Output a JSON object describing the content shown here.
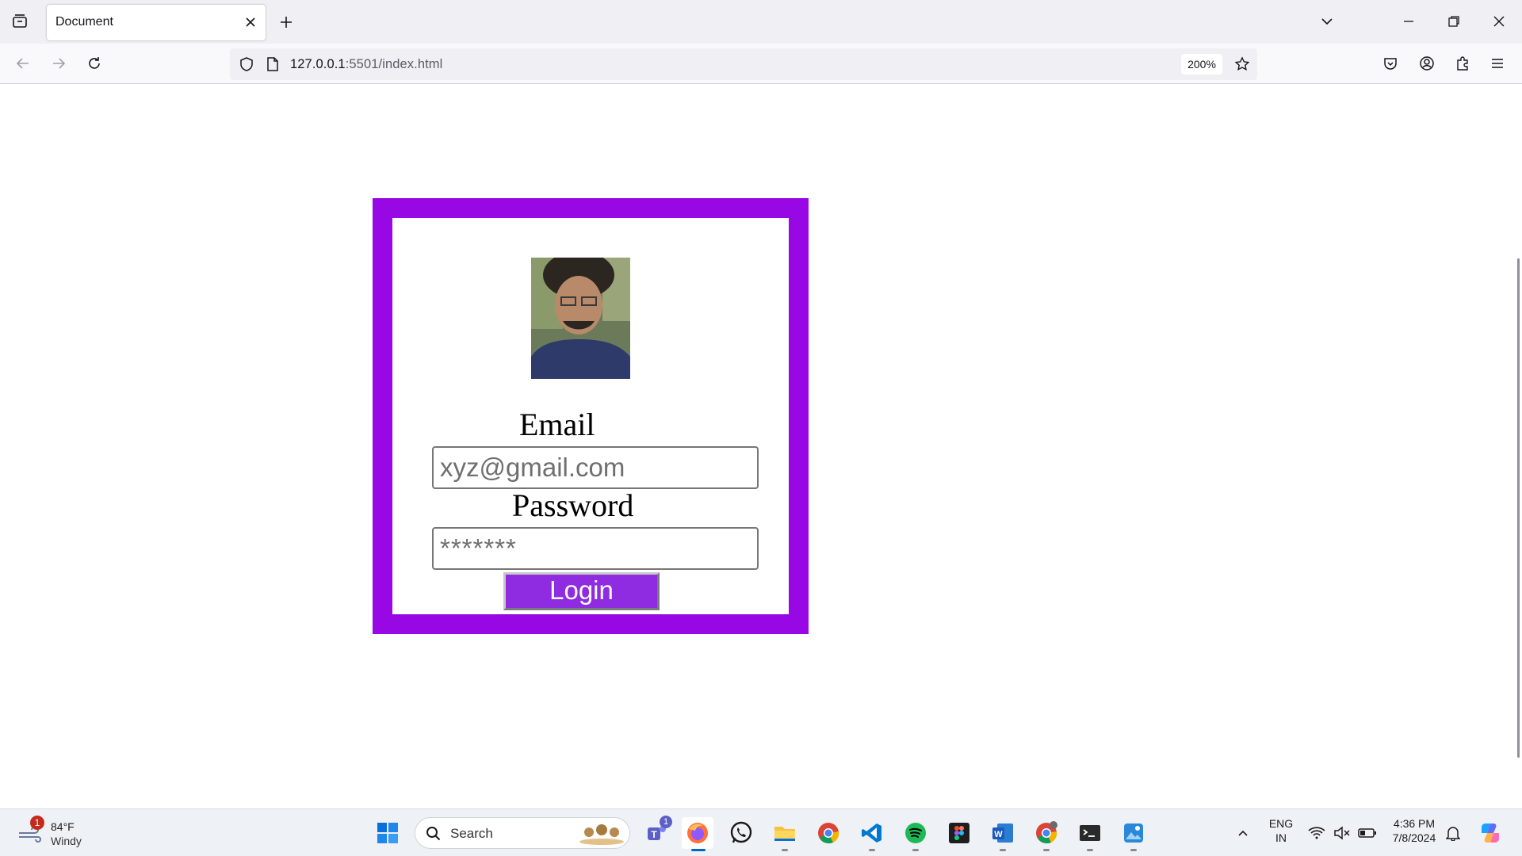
{
  "browser": {
    "tab_title": "Document",
    "url_host": "127.0.0.1",
    "url_path": ":5501/index.html",
    "zoom": "200%"
  },
  "page": {
    "email_label": "Email",
    "email_placeholder": "xyz@gmail.com",
    "password_label": "Password",
    "password_placeholder": "*******",
    "login_button": "Login",
    "card_border_color": "#9808e4",
    "button_color": "#8f2be1"
  },
  "taskbar": {
    "weather_temp": "84°F",
    "weather_condition": "Windy",
    "weather_badge": "1",
    "search_label": "Search",
    "teams_badge": "1",
    "lang_primary": "ENG",
    "lang_secondary": "IN",
    "time": "4:36 PM",
    "date": "7/8/2024",
    "pinned_apps": [
      "windows-start",
      "teams",
      "firefox",
      "whatsapp",
      "file-explorer",
      "chrome",
      "vscode",
      "spotify",
      "figma",
      "word",
      "chrome-profile",
      "terminal",
      "photos"
    ]
  }
}
